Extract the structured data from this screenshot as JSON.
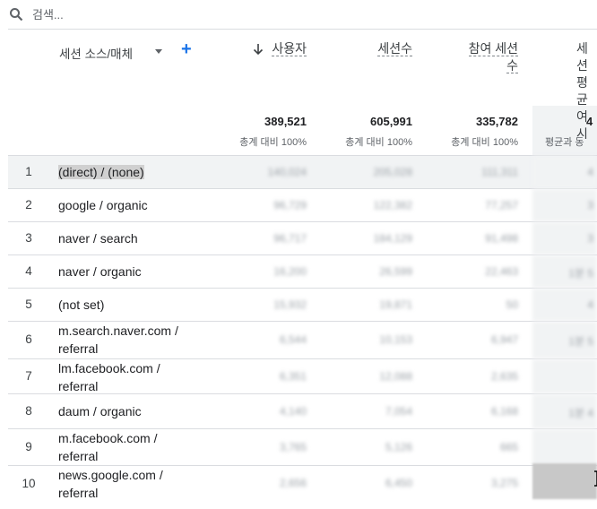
{
  "search": {
    "placeholder": "검색..."
  },
  "header": {
    "dimension_label": "세션 소스/매체",
    "add_label": "+",
    "metrics": [
      {
        "name": "사용자",
        "total": "389,521",
        "pct": "총계 대비 100%"
      },
      {
        "name": "세션수",
        "total": "605,991",
        "pct": "총계 대비 100%"
      },
      {
        "name_line1": "참여 세션",
        "name_line2": "수",
        "total": "335,782",
        "pct": "총계 대비 100%"
      },
      {
        "name_line1": "세션",
        "name_line2": "평균",
        "name_line3": "여 시",
        "total": "4",
        "pct": "평균과 동"
      }
    ]
  },
  "rows": [
    {
      "rank": "1",
      "label": "(direct) / (none)",
      "v": [
        "140,024",
        "205,028",
        "111,311",
        "4"
      ]
    },
    {
      "rank": "2",
      "label": "google / organic",
      "v": [
        "96,729",
        "122,382",
        "77,257",
        "3"
      ]
    },
    {
      "rank": "3",
      "label": "naver / search",
      "v": [
        "96,717",
        "184,129",
        "91,498",
        "3"
      ]
    },
    {
      "rank": "4",
      "label": "naver / organic",
      "v": [
        "16,200",
        "26,599",
        "22,463",
        "1분 5"
      ]
    },
    {
      "rank": "5",
      "label": "(not set)",
      "v": [
        "15,932",
        "19,871",
        "50",
        "4"
      ]
    },
    {
      "rank": "6",
      "label_line1": "m.search.naver.com /",
      "label_line2": "referral",
      "v": [
        "6,544",
        "10,153",
        "6,947",
        "1분 5"
      ]
    },
    {
      "rank": "7",
      "label_line1": "lm.facebook.com /",
      "label_line2": "referral",
      "v": [
        "6,351",
        "12,088",
        "2,635",
        ""
      ]
    },
    {
      "rank": "8",
      "label": "daum / organic",
      "v": [
        "4,140",
        "7,054",
        "6,168",
        "1분 4"
      ]
    },
    {
      "rank": "9",
      "label_line1": "m.facebook.com /",
      "label_line2": "referral",
      "v": [
        "3,765",
        "5,126",
        "665",
        ""
      ]
    },
    {
      "rank": "10",
      "label_line1": "news.google.com /",
      "label_line2": "referral",
      "v": [
        "2,656",
        "6,450",
        "3,275",
        ""
      ]
    }
  ]
}
